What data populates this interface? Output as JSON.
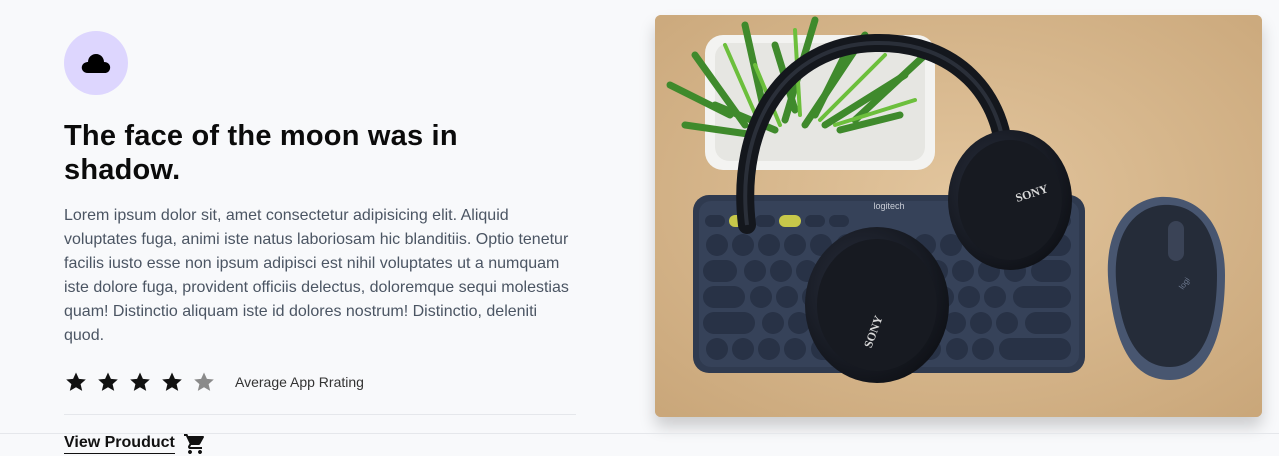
{
  "feature": {
    "icon": "cloud-icon",
    "icon_bg": "#ddd6fe",
    "title": "The face of the moon was in shadow.",
    "description": "Lorem ipsum dolor sit, amet consectetur adipisicing elit. Aliquid voluptates fuga, animi iste natus laboriosam hic blanditiis. Optio tenetur facilis iusto esse non ipsum adipisci est nihil voluptates ut a numquam iste dolore fuga, provident officiis delectus, doloremque sequi molestias quam! Distinctio aliquam iste id dolores nostrum! Distinctio, deleniti quod.",
    "rating": {
      "value": 4,
      "max": 5,
      "label": "Average App Rrating"
    },
    "link": {
      "label": "View Prouduct",
      "icon": "cart-icon"
    }
  },
  "image": {
    "alt": "headphones, keyboard, mouse and plant on desk",
    "keyboard_brand": "logitech",
    "headphone_brand": "SONY"
  }
}
